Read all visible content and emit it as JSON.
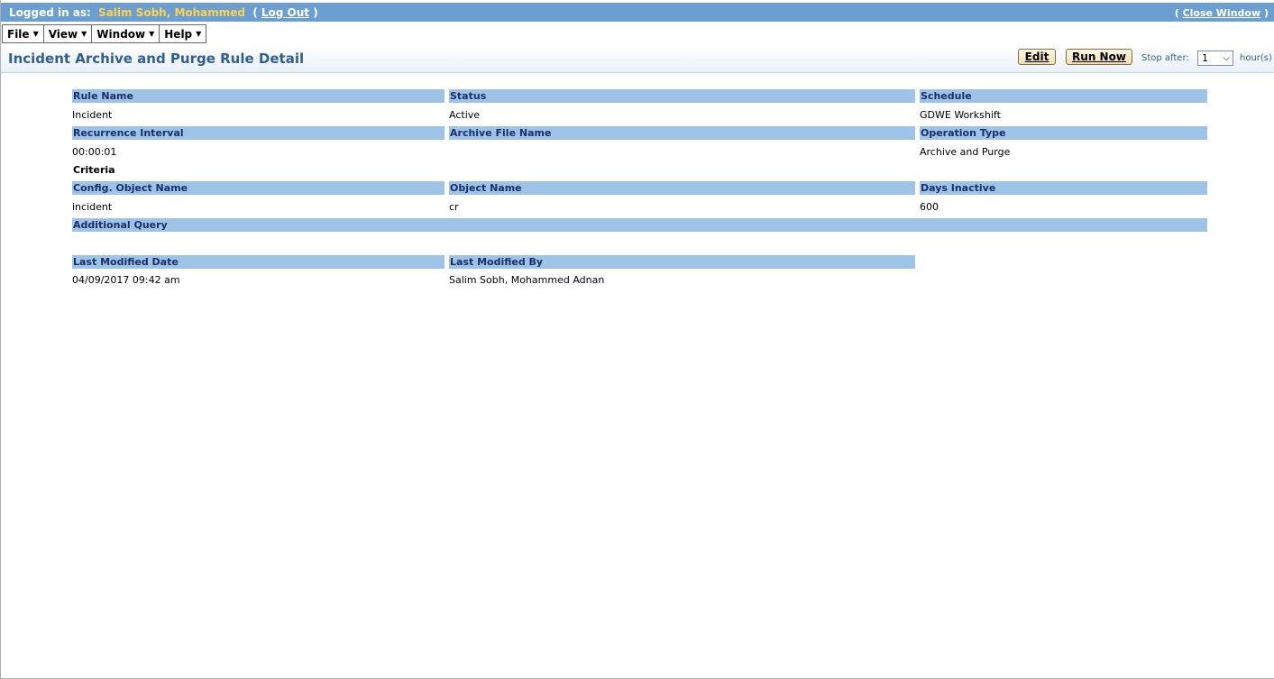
{
  "header": {
    "logged_in_label": "Logged in as:",
    "user_name": "Salim Sobh, Mohammed",
    "logout_label": "Log Out",
    "close_window_label": "Close Window"
  },
  "menu": {
    "items": [
      {
        "label": "File"
      },
      {
        "label": "View"
      },
      {
        "label": "Window"
      },
      {
        "label": "Help"
      }
    ]
  },
  "page": {
    "title": "Incident Archive and Purge Rule Detail",
    "edit_label": "Edit",
    "run_now_label": "Run Now",
    "stop_after_label": "Stop after:",
    "stop_after_value": "1",
    "hours_label": "hour(s)"
  },
  "detail": {
    "rule_name_label": "Rule Name",
    "rule_name": "Incident",
    "status_label": "Status",
    "status": "Active",
    "schedule_label": "Schedule",
    "schedule": "GDWE Workshift",
    "recurrence_label": "Recurrence Interval",
    "recurrence": "00:00:01",
    "archive_file_label": "Archive File Name",
    "archive_file": "",
    "operation_type_label": "Operation Type",
    "operation_type": "Archive and Purge",
    "criteria_label": "Criteria",
    "config_object_label": "Config. Object Name",
    "config_object": "incident",
    "object_name_label": "Object Name",
    "object_name": "cr",
    "days_inactive_label": "Days Inactive",
    "days_inactive": "600",
    "additional_query_label": "Additional Query",
    "additional_query": "",
    "last_modified_date_label": "Last Modified Date",
    "last_modified_date": "04/09/2017 09:42 am",
    "last_modified_by_label": "Last Modified By",
    "last_modified_by": "Salim Sobh, Mohammed Adnan"
  }
}
